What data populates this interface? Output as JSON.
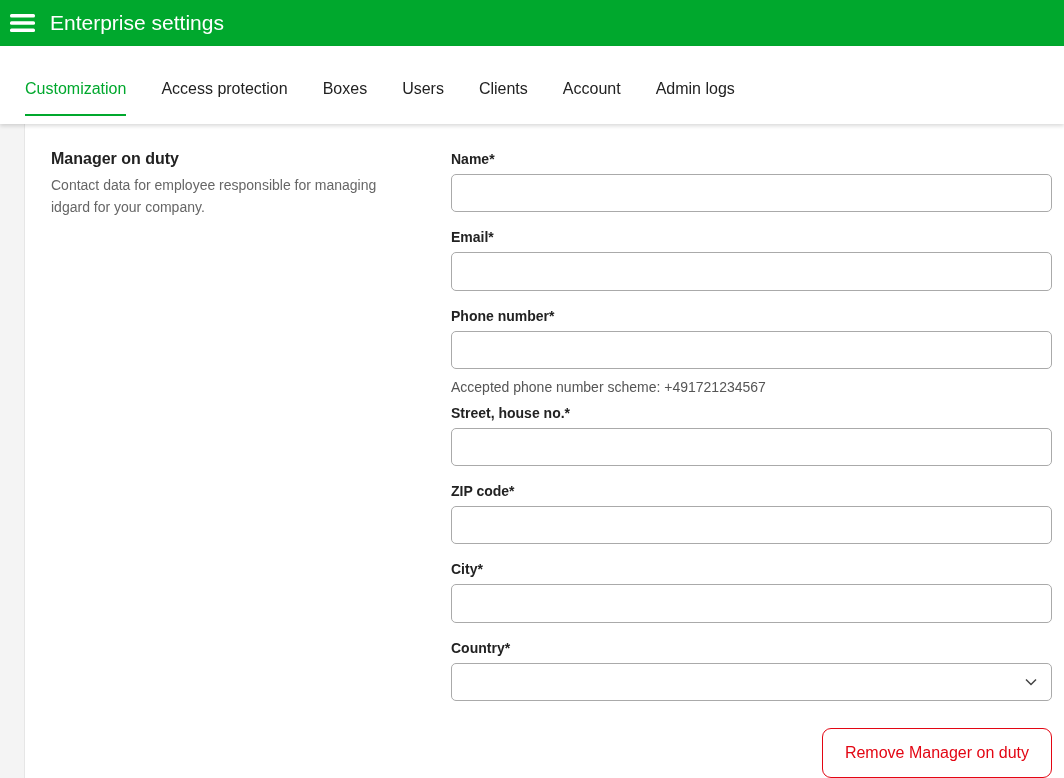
{
  "header": {
    "title": "Enterprise settings"
  },
  "tabs": [
    {
      "label": "Customization",
      "selected": true
    },
    {
      "label": "Access protection",
      "selected": false
    },
    {
      "label": "Boxes",
      "selected": false
    },
    {
      "label": "Users",
      "selected": false
    },
    {
      "label": "Clients",
      "selected": false
    },
    {
      "label": "Account",
      "selected": false
    },
    {
      "label": "Admin logs",
      "selected": false
    }
  ],
  "section": {
    "title": "Manager on duty",
    "description": "Contact data for employee responsible for managing idgard for your company."
  },
  "fields": [
    {
      "kind": "text",
      "label": "Name*"
    },
    {
      "kind": "text",
      "label": "Email*"
    },
    {
      "kind": "text",
      "label": "Phone number*",
      "hint": "Accepted phone number scheme: +491721234567"
    },
    {
      "kind": "text",
      "label": "Street, house no.*"
    },
    {
      "kind": "text",
      "label": "ZIP code*"
    },
    {
      "kind": "text",
      "label": "City*"
    },
    {
      "kind": "select",
      "label": "Country*"
    }
  ],
  "remove_button": {
    "label": "Remove Manager on duty"
  }
}
